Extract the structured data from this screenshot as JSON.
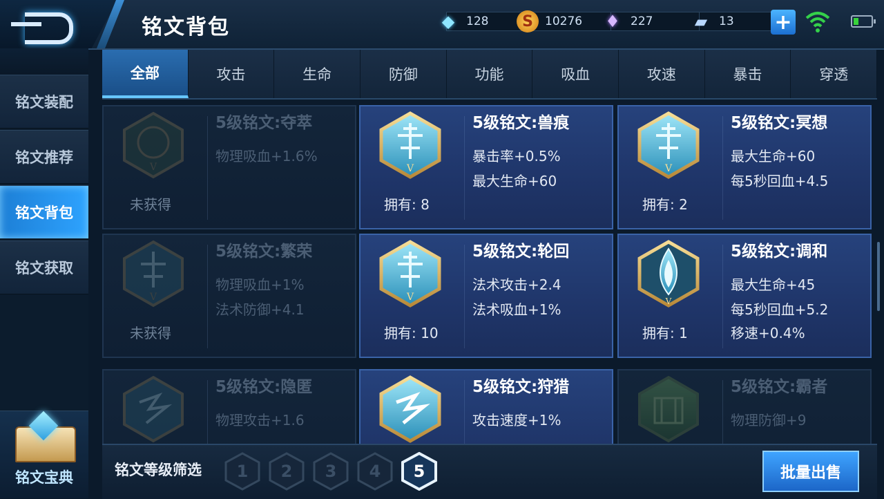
{
  "header": {
    "title": "铭文背包",
    "resources": [
      {
        "icon": "diamond-icon",
        "value": "128"
      },
      {
        "icon": "gold-coin-icon",
        "value": "10276"
      },
      {
        "icon": "gem-icon",
        "value": "227"
      },
      {
        "icon": "card-icon",
        "value": "13"
      }
    ]
  },
  "sidebar": {
    "items": [
      {
        "label": "铭文装配"
      },
      {
        "label": "铭文推荐"
      },
      {
        "label": "铭文背包"
      },
      {
        "label": "铭文获取"
      }
    ],
    "codex_label": "铭文宝典"
  },
  "tabs": [
    "全部",
    "攻击",
    "生命",
    "防御",
    "功能",
    "吸血",
    "攻速",
    "暴击",
    "穿透"
  ],
  "cards": [
    {
      "name": "5级铭文:夺萃",
      "stats": [
        "物理吸血+1.6%"
      ],
      "owned": "未获得",
      "locked": true,
      "emblem": "green-emblem"
    },
    {
      "name": "5级铭文:兽痕",
      "stats": [
        "暴击率+0.5%",
        "最大生命+60"
      ],
      "owned": "拥有: 8",
      "locked": false,
      "emblem": "blue-emblem"
    },
    {
      "name": "5级铭文:冥想",
      "stats": [
        "最大生命+60",
        "每5秒回血+4.5"
      ],
      "owned": "拥有: 2",
      "locked": false,
      "emblem": "blue-emblem"
    },
    {
      "name": "5级铭文:繁荣",
      "stats": [
        "物理吸血+1%",
        "法术防御+4.1"
      ],
      "owned": "未获得",
      "locked": true,
      "emblem": "blue-emblem"
    },
    {
      "name": "5级铭文:轮回",
      "stats": [
        "法术攻击+2.4",
        "法术吸血+1%"
      ],
      "owned": "拥有: 10",
      "locked": false,
      "emblem": "blue-emblem"
    },
    {
      "name": "5级铭文:调和",
      "stats": [
        "最大生命+45",
        "每5秒回血+5.2",
        "移速+0.4%"
      ],
      "owned": "拥有: 1",
      "locked": false,
      "emblem": "drop-emblem"
    },
    {
      "name": "5级铭文:隐匿",
      "stats": [
        "物理攻击+1.6"
      ],
      "owned": "",
      "locked": true,
      "emblem": "lightning-emblem"
    },
    {
      "name": "5级铭文:狩猎",
      "stats": [
        "攻击速度+1%"
      ],
      "owned": "",
      "locked": false,
      "emblem": "lightning-emblem"
    },
    {
      "name": "5级铭文:霸者",
      "stats": [
        "物理防御+9"
      ],
      "owned": "",
      "locked": true,
      "emblem": "green-emblem"
    }
  ],
  "filter": {
    "label": "铭文等级筛选",
    "levels": [
      "1",
      "2",
      "3",
      "4",
      "5"
    ],
    "active_level": "5",
    "sell_label": "批量出售"
  }
}
